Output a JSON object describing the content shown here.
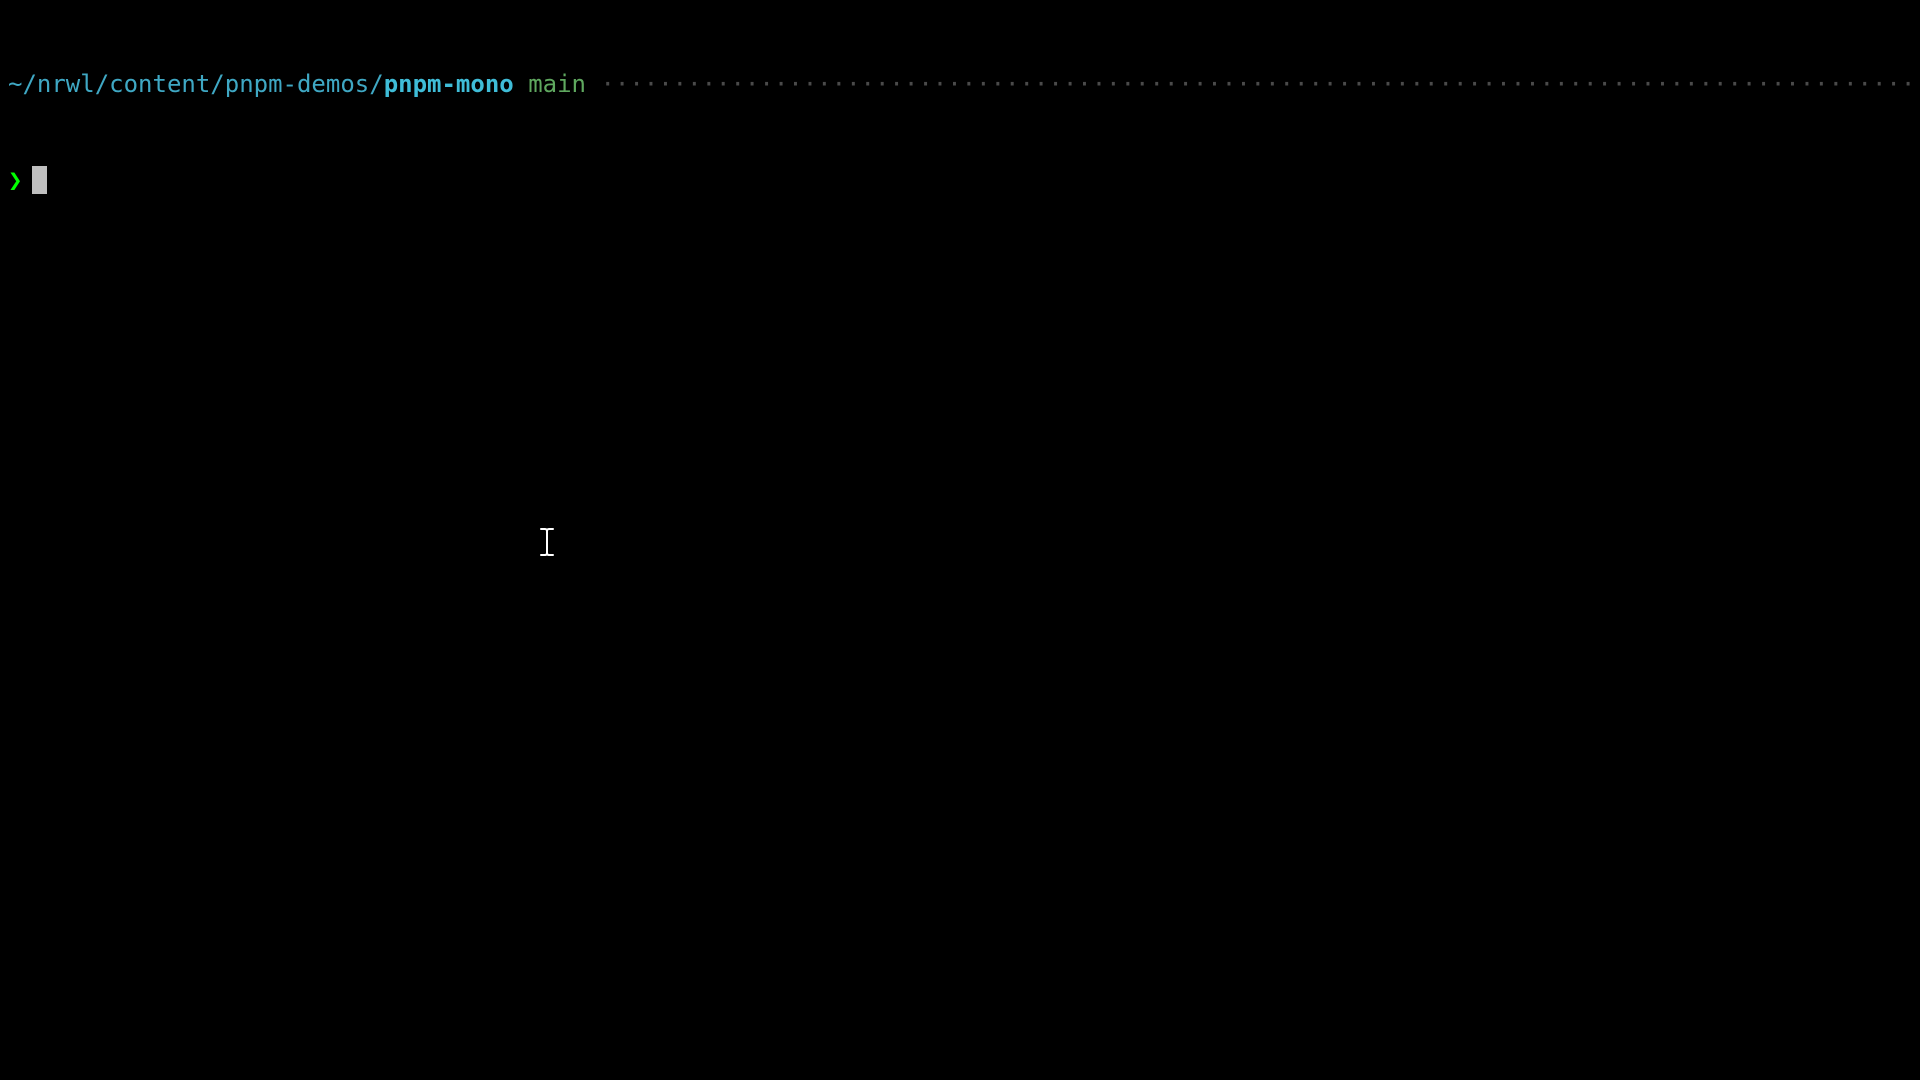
{
  "prompt": {
    "path_parent": "~/nrwl/content/pnpm-demos/",
    "path_current": "pnpm-mono",
    "space1": " ",
    "branch": "main",
    "space2": " ",
    "dots": "·····················································································································",
    "symbol": "❯",
    "command": ""
  }
}
